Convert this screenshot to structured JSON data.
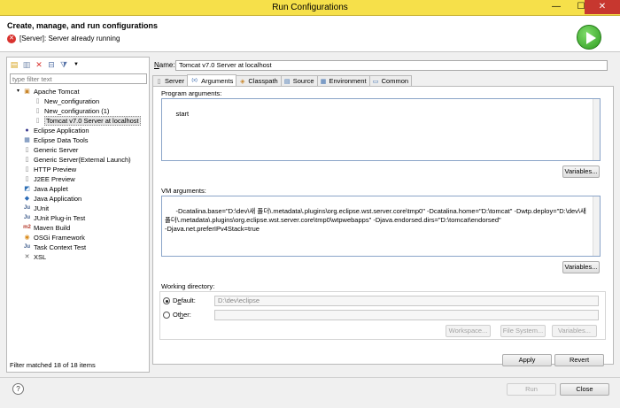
{
  "window": {
    "title": "Run Configurations"
  },
  "header": {
    "title": "Create, manage, and run configurations",
    "message": "[Server]: Server already running"
  },
  "left": {
    "filter_placeholder": "type filter text",
    "tree": [
      {
        "label": "Apache Tomcat",
        "level": 0,
        "icon": "tomcat-icon"
      },
      {
        "label": "New_configuration",
        "level": 1,
        "icon": "server-config-icon"
      },
      {
        "label": "New_configuration (1)",
        "level": 1,
        "icon": "server-config-icon"
      },
      {
        "label": "Tomcat v7.0 Server at localhost",
        "level": 1,
        "icon": "server-config-icon",
        "selected": true
      },
      {
        "label": "Eclipse Application",
        "level": 0,
        "icon": "eclipse-icon"
      },
      {
        "label": "Eclipse Data Tools",
        "level": 0,
        "icon": "data-tools-icon"
      },
      {
        "label": "Generic Server",
        "level": 0,
        "icon": "server-icon"
      },
      {
        "label": "Generic Server(External Launch)",
        "level": 0,
        "icon": "server-icon"
      },
      {
        "label": "HTTP Preview",
        "level": 0,
        "icon": "server-icon"
      },
      {
        "label": "J2EE Preview",
        "level": 0,
        "icon": "server-icon"
      },
      {
        "label": "Java Applet",
        "level": 0,
        "icon": "applet-icon"
      },
      {
        "label": "Java Application",
        "level": 0,
        "icon": "java-app-icon"
      },
      {
        "label": "JUnit",
        "level": 0,
        "icon": "junit-icon"
      },
      {
        "label": "JUnit Plug-in Test",
        "level": 0,
        "icon": "junit-plugin-icon"
      },
      {
        "label": "Maven Build",
        "level": 0,
        "icon": "maven-icon"
      },
      {
        "label": "OSGi Framework",
        "level": 0,
        "icon": "osgi-icon"
      },
      {
        "label": "Task Context Test",
        "level": 0,
        "icon": "task-icon"
      },
      {
        "label": "XSL",
        "level": 0,
        "icon": "xsl-icon"
      }
    ],
    "filter_status": "Filter matched 18 of 18 items"
  },
  "config": {
    "name_label": "Name:",
    "name_value": "Tomcat v7.0 Server at localhost",
    "tabs": [
      {
        "label": "Server",
        "icon": "server-tab-icon"
      },
      {
        "label": "Arguments",
        "icon": "arguments-tab-icon",
        "active": true
      },
      {
        "label": "Classpath",
        "icon": "classpath-tab-icon"
      },
      {
        "label": "Source",
        "icon": "source-tab-icon"
      },
      {
        "label": "Environment",
        "icon": "environment-tab-icon"
      },
      {
        "label": "Common",
        "icon": "common-tab-icon"
      }
    ],
    "program_args_label": "Program arguments:",
    "program_args_value": "start",
    "vm_args_label": "VM arguments:",
    "vm_args_value": "-Dcatalina.base=\"D:\\dev\\새 폴더\\.metadata\\.plugins\\org.eclipse.wst.server.core\\tmp0\" -Dcatalina.home=\"D:\\tomcat\" -Dwtp.deploy=\"D:\\dev\\새 폴더\\.metadata\\.plugins\\org.eclipse.wst.server.core\\tmp0\\wtpwebapps\" -Djava.endorsed.dirs=\"D:\\tomcat\\endorsed\"\n-Djava.net.preferIPv4Stack=true",
    "variables_label": "Variables...",
    "working_dir_label": "Working directory:",
    "default_label": "Default:",
    "default_value": "D:\\dev\\eclipse",
    "other_label": "Other:",
    "other_value": "",
    "workspace_label": "Workspace...",
    "filesystem_label": "File System...",
    "variables2_label": "Variables...",
    "apply_label": "Apply",
    "revert_label": "Revert"
  },
  "footer": {
    "run_label": "Run",
    "close_label": "Close"
  }
}
